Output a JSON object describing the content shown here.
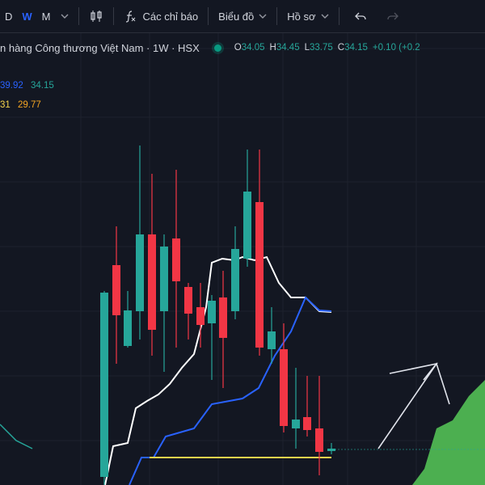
{
  "toolbar": {
    "intervals": [
      "D",
      "W",
      "M"
    ],
    "active_interval": "W",
    "indicators_label": "Các chỉ báo",
    "chart_label": "Biểu đồ",
    "profile_label": "Hồ sơ"
  },
  "title": {
    "text": "n hàng Công thương Việt Nam · 1W · HSX",
    "o_label": "O",
    "o_value": "34.05",
    "h_label": "H",
    "h_value": "34.45",
    "l_label": "L",
    "l_value": "33.75",
    "c_label": "C",
    "c_value": "34.15",
    "change": "+0.10 (+0.2"
  },
  "indicators": {
    "line1_a": "39.92",
    "line1_b": "34.15",
    "line2_a": "31",
    "line2_b": "29.77"
  },
  "colors": {
    "up": "#26a69a",
    "down": "#f23645",
    "blue_line": "#2962ff",
    "white_line": "#ffffff",
    "yellow_line": "#f5d34c",
    "cloud": "#4caf50",
    "background": "#131722"
  }
}
